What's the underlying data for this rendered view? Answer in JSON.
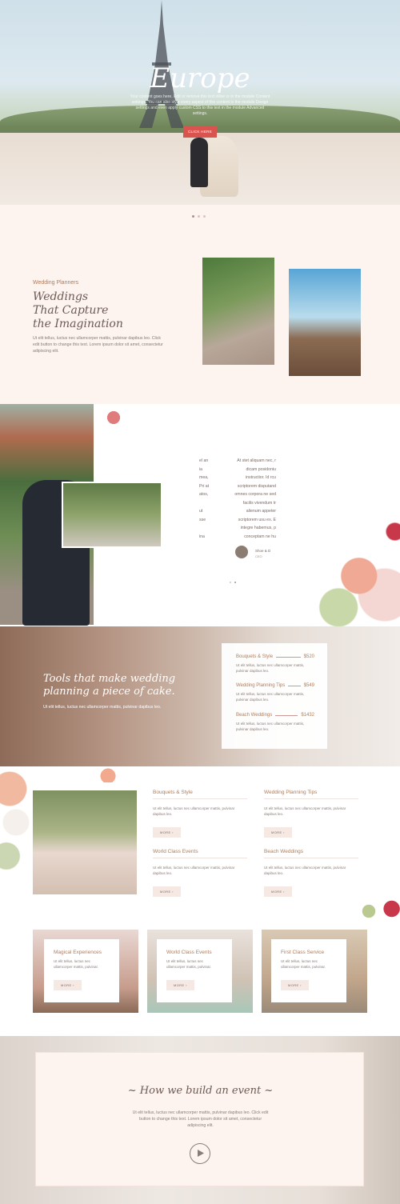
{
  "hero": {
    "title": "Europe",
    "text": "Your content goes here. Edit or remove this text inline or in the module Content settings. You can also style every aspect of this content in the module Design settings and even apply custom CSS to this text in the module Advanced settings.",
    "button": "CLICK HERE"
  },
  "planners": {
    "eyebrow": "Wedding Planners",
    "heading_lines": [
      "Weddings",
      "That Capture",
      "the Imagination"
    ],
    "body": "Ut elit tellus, luctus nec ullamcorper mattis, pulvinar dapibus leo. Click edit button to change this text. Lorem ipsum dolor sit amet, consectetur adipiscing elit."
  },
  "testimonial": {
    "col_left": [
      "el an",
      "ia",
      "mea,",
      "Pri at",
      "atos,",
      "",
      "ut",
      "sse",
      "",
      "ina"
    ],
    "col_right": [
      "At stet aliquam nec, r",
      "dicam posidoniu",
      "instructior. Id rcu",
      "scriptorem disputand",
      "omnes corpora ne sed",
      "facilis vivendum tr",
      "alienum appeter",
      "scriptorem usu ex. E",
      "integre habemus, p",
      "conceptam ne hu"
    ],
    "author_name": "Shoe & D",
    "author_role": "CEO"
  },
  "tools": {
    "heading_lines": [
      "Tools that make wedding",
      "planning a piece of cake."
    ],
    "body": "Ut elit tellus, luctus nec ullamcorper mattis, pulvinar dapibus leo.",
    "prices": [
      {
        "label": "Bouquets & Style",
        "price": "$520",
        "desc": "Ut elit tellus, luctus nec ullamcorper mattis, pulvinar dapibus leo."
      },
      {
        "label": "Wedding Planning Tips",
        "price": "$549",
        "desc": "Ut elit tellus, luctus nec ullamcorper mattis, pulvinar dapibus leo."
      },
      {
        "label": "Beach Weddings",
        "price": "$1432",
        "desc": "Ut elit tellus, luctus nec ullamcorper mattis, pulvinar dapibus leo."
      }
    ]
  },
  "services": [
    {
      "title": "Bouquets & Style",
      "text": "Ut elit tellus, luctus nec ullamcorper mattis, pulvinar dapibus leo.",
      "button": "MORE ›"
    },
    {
      "title": "Wedding Planning Tips",
      "text": "Ut elit tellus, luctus nec ullamcorper mattis, pulvinar dapibus leo.",
      "button": "MORE ›"
    },
    {
      "title": "World Class Events",
      "text": "Ut elit tellus, luctus nec ullamcorper mattis, pulvinar dapibus leo.",
      "button": "MORE ›"
    },
    {
      "title": "Beach Weddings",
      "text": "Ut elit tellus, luctus nec ullamcorper mattis, pulvinar dapibus leo.",
      "button": "MORE ›"
    }
  ],
  "cards": [
    {
      "title": "Magical Experiences",
      "text": "Ut elit tellus, luctus nec ullamcorper mattis, pulvinar.",
      "button": "MORE ›"
    },
    {
      "title": "World Class Events",
      "text": "Ut elit tellus, luctus nec ullamcorper mattis, pulvinar.",
      "button": "MORE ›"
    },
    {
      "title": "First Class Service",
      "text": "Ut elit tellus, luctus nec ullamcorper mattis, pulvinar.",
      "button": "MORE ›"
    }
  ],
  "build": {
    "title": "~ How we build an event ~",
    "body": "Ut elit tellus, luctus nec ullamcorper mattis, pulvinar dapibus leo. Click edit button to change this text. Lorem ipsum dolor sit amet, consectetur adipiscing elit."
  },
  "colors": {
    "accent": "#b07c5a",
    "hero_button": "#d9534f",
    "background": "#fdf3ef"
  },
  "icons": [
    "play-icon"
  ]
}
